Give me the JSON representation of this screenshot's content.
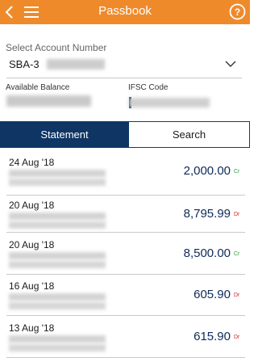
{
  "header": {
    "title": "Passbook"
  },
  "account": {
    "label": "Select Account Number",
    "value_prefix": "SBA-3"
  },
  "details": {
    "balance_label": "Available Balance",
    "ifsc_label": "IFSC Code"
  },
  "tabs": [
    {
      "label": "Statement",
      "active": true
    },
    {
      "label": "Search",
      "active": false
    }
  ],
  "transactions": [
    {
      "date": "24 Aug '18",
      "amount": "2,000.00",
      "type": "Cr"
    },
    {
      "date": "20 Aug '18",
      "amount": "8,795.99",
      "type": "Dr"
    },
    {
      "date": "20 Aug '18",
      "amount": "8,500.00",
      "type": "Cr"
    },
    {
      "date": "16 Aug '18",
      "amount": "605.90",
      "type": "Dr"
    },
    {
      "date": "13 Aug '18",
      "amount": "615.90",
      "type": "Dr"
    }
  ],
  "colors": {
    "header": "#ef8a2b",
    "tab_active": "#0e3564",
    "credit": "#2e9b3a",
    "debit": "#d8262b"
  }
}
